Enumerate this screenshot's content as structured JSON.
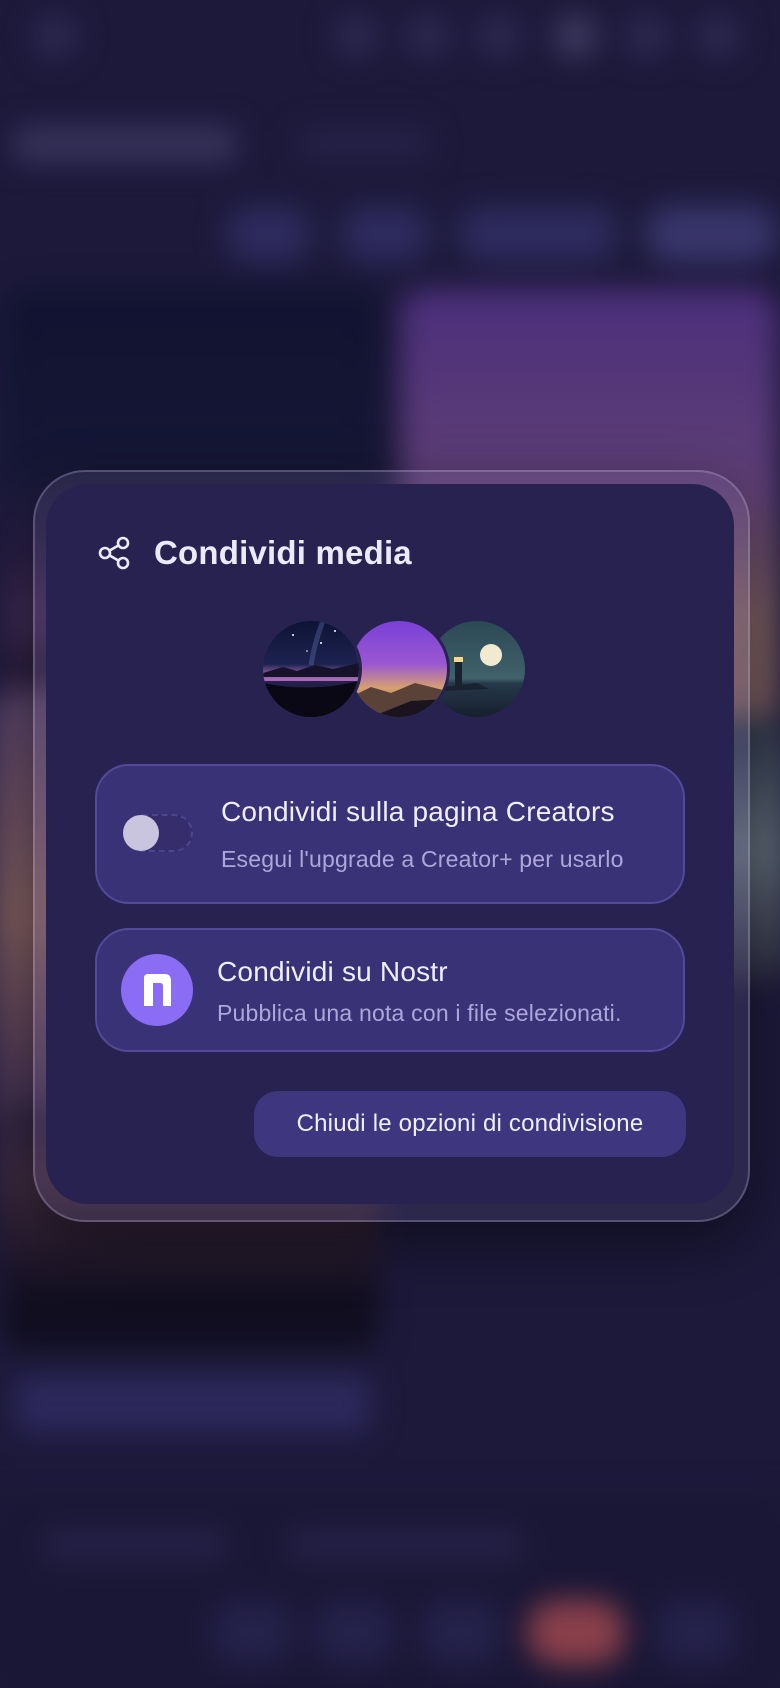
{
  "dialog": {
    "title": "Condividi media",
    "header_icon": "share-icon",
    "thumbnails": [
      {
        "icon": "night-lake-thumbnail"
      },
      {
        "icon": "purple-sunset-thumbnail"
      },
      {
        "icon": "lighthouse-moon-thumbnail"
      }
    ],
    "options": {
      "creators": {
        "title": "Condividi sulla pagina Creators",
        "subtitle": "Esegui l'upgrade a Creator+ per usarlo",
        "toggle_on": false
      },
      "nostr": {
        "title": "Condividi su Nostr",
        "subtitle": "Pubblica una nota con i file selezionati.",
        "icon": "nostr-icon"
      }
    },
    "close_label": "Chiudi le opzioni di condivisione"
  },
  "colors": {
    "dialog_bg": "#272250",
    "card_bg": "#3a3276",
    "accent": "#8b6cf4",
    "text_primary": "#f0eefc",
    "text_secondary": "#aea7da"
  }
}
